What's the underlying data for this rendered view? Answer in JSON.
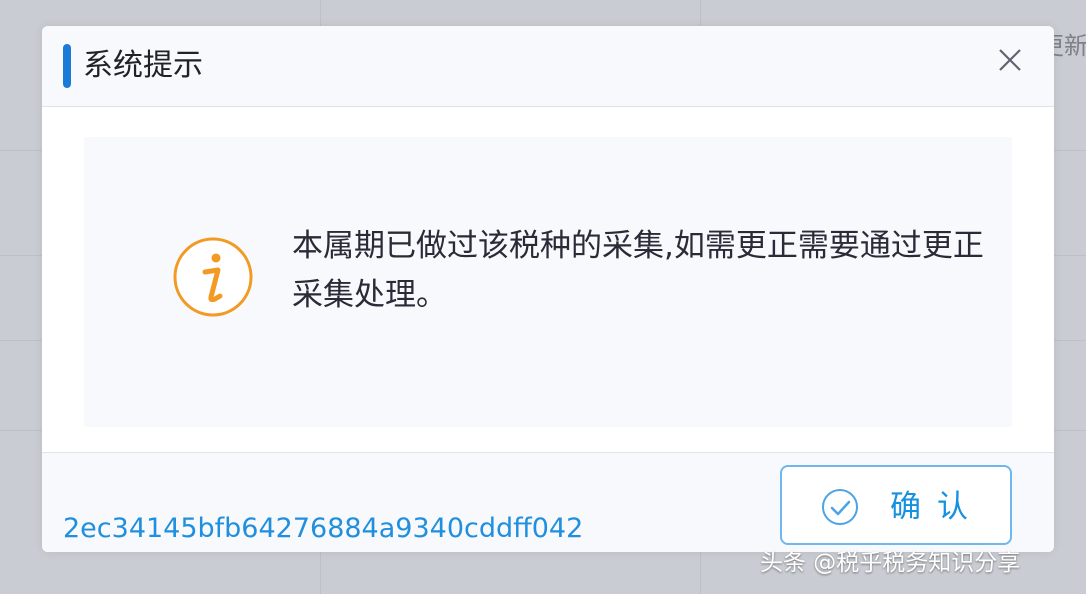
{
  "dialog": {
    "title": "系统提示",
    "close_icon": "close-icon",
    "info_icon": "info-icon",
    "message": "本属期已做过该税种的采集,如需更正需要通过更正采集处理。",
    "footer_code": "2ec34145bfb64276884a9340cddff042",
    "confirm_button": {
      "label": "确认",
      "icon": "check-circle-icon"
    }
  },
  "background": {
    "partial_text": "更新属"
  },
  "watermark": {
    "text": "头条 @税乎税务知识分享"
  },
  "colors": {
    "accent": "#1a7ad8",
    "info": "#f29a24",
    "link": "#1f8fde",
    "button_border": "#6fb7ee"
  }
}
